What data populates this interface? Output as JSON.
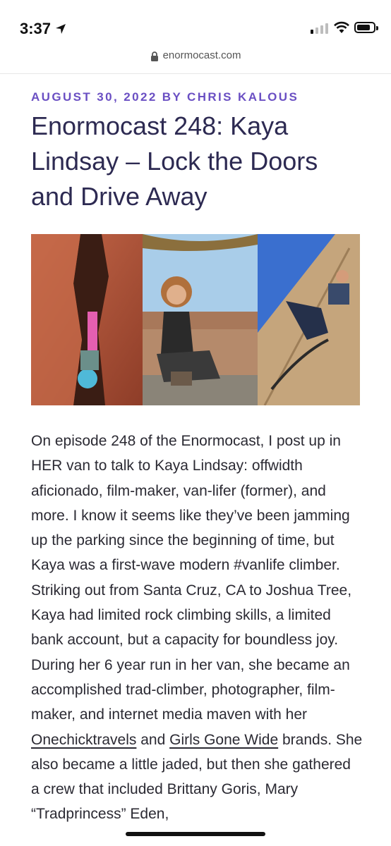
{
  "status_bar": {
    "time": "3:37"
  },
  "browser": {
    "url": "enormocast.com"
  },
  "article": {
    "meta": "AUGUST 30, 2022 BY CHRIS KALOUS",
    "title": "Enormocast 248: Kaya Lindsay – Lock the Doors and Drive Away",
    "body_part1": "On episode 248 of the Enormocast, I post up in HER van to talk to Kaya Lindsay: offwidth aficionado, film-maker, van-lifer (former), and more. I know it seems like they’ve been jamming up the parking since the beginning of time, but Kaya was a first-wave modern #vanlife climber. Striking out from Santa Cruz, CA to Joshua Tree, Kaya had limited rock climbing skills, a limited bank account, but a capacity for boundless joy. During her 6 year run in her van, she became an accomplished trad-climber, photographer, film-maker, and internet media maven with her ",
    "link1": "Onechicktravels",
    "body_part2": " and ",
    "link2": "Girls Gone Wide",
    "body_part3": " brands. She also became a little jaded, but then she gathered a crew that included Brittany Goris, Mary “Tradprincess” Eden,"
  },
  "icons": [
    "location-arrow-icon",
    "cellular-signal-icon",
    "wifi-icon",
    "battery-icon",
    "lock-icon"
  ],
  "colors": {
    "meta": "#6a4fc3",
    "title": "#2d2a52",
    "body": "#2b2a33"
  }
}
